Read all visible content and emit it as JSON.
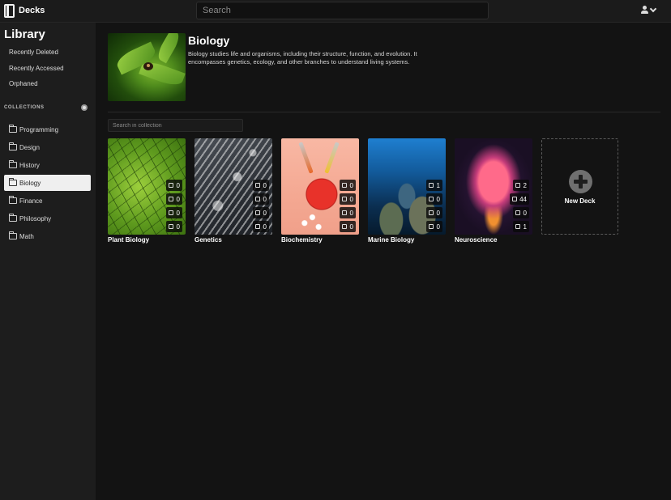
{
  "app": {
    "title": "Decks"
  },
  "header": {
    "search_placeholder": "Search"
  },
  "sidebar": {
    "title": "Library",
    "nav": [
      {
        "label": "Recently Deleted"
      },
      {
        "label": "Recently Accessed"
      },
      {
        "label": "Orphaned"
      }
    ],
    "collections_header": "COLLECTIONS",
    "collections": [
      {
        "label": "Programming"
      },
      {
        "label": "Design"
      },
      {
        "label": "History"
      },
      {
        "label": "Biology"
      },
      {
        "label": "Finance"
      },
      {
        "label": "Philosophy"
      },
      {
        "label": "Math"
      }
    ],
    "active_collection": "Biology"
  },
  "collection": {
    "title": "Biology",
    "description": "Biology studies life and organisms, including their structure, function, and evolution. It encompasses genetics, ecology, and other branches to understand living systems.",
    "search_placeholder": "Search in collection"
  },
  "decks": [
    {
      "name": "Plant Biology",
      "stats": [
        "0",
        "0",
        "0",
        "0"
      ]
    },
    {
      "name": "Genetics",
      "stats": [
        "0",
        "0",
        "0",
        "0"
      ]
    },
    {
      "name": "Biochemistry",
      "stats": [
        "0",
        "0",
        "0",
        "0"
      ]
    },
    {
      "name": "Marine Biology",
      "stats": [
        "1",
        "0",
        "0",
        "0"
      ]
    },
    {
      "name": "Neuroscience",
      "stats": [
        "2",
        "44",
        "0",
        "1"
      ]
    }
  ],
  "new_deck": {
    "label": "New Deck"
  },
  "icons": {
    "stat_icons": [
      "thumb-icon",
      "cards-icon",
      "review-icon",
      "note-icon"
    ]
  }
}
